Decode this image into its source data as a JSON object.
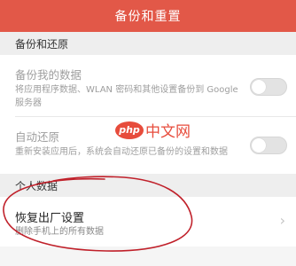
{
  "appbar": {
    "title": "备份和重置"
  },
  "sections": {
    "backup_restore": "备份和还原",
    "personal_data": "个人数据"
  },
  "backup_data": {
    "title": "备份我的数据",
    "subtitle": "将应用程序数据、WLAN 密码和其他设置备份到 Google 服务器",
    "enabled": false
  },
  "auto_restore": {
    "title": "自动还原",
    "subtitle": "重新安装应用后，系统会自动还原已备份的设置和数据",
    "enabled": false
  },
  "factory_reset": {
    "title": "恢复出厂设置",
    "subtitle": "删除手机上的所有数据"
  },
  "watermark": {
    "logo": "php",
    "text": "中文网"
  },
  "colors": {
    "appbar": "#e25848",
    "annotation": "#c0202a",
    "watermark": "#e74c3c"
  },
  "icons": {
    "chevron": "chevron-right-icon"
  }
}
